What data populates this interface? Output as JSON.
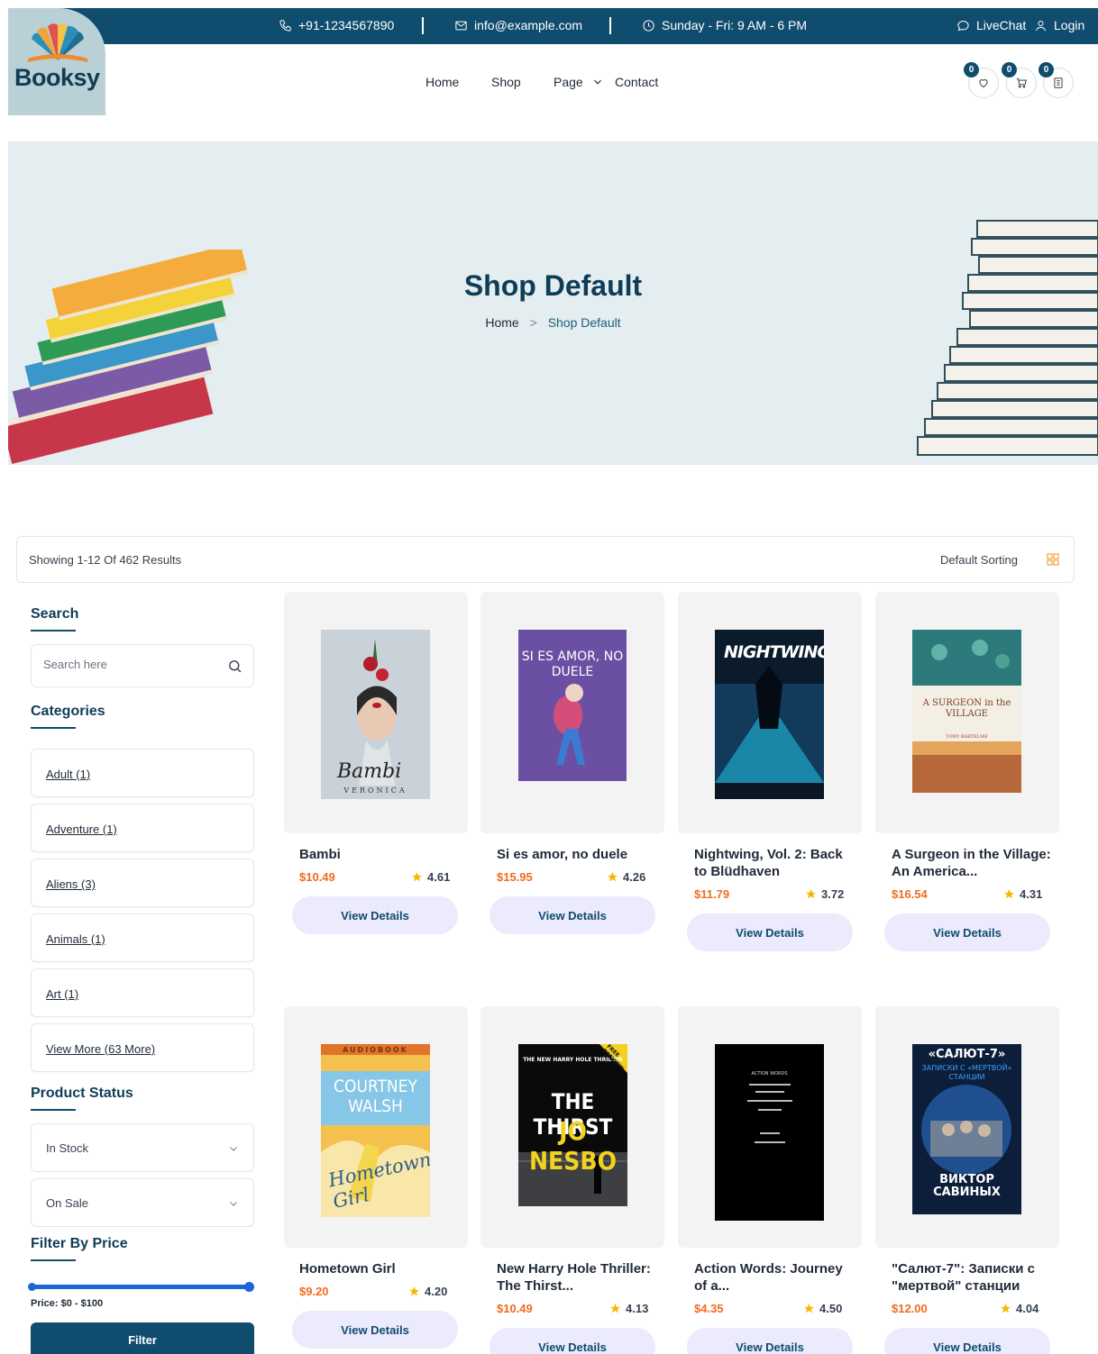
{
  "topbar": {
    "phone": "+91-1234567890",
    "email": "info@example.com",
    "hours": "Sunday - Fri: 9 AM - 6 PM",
    "livechat": "LiveChat",
    "login": "Login"
  },
  "logo": {
    "text": "Booksy"
  },
  "nav": {
    "home": "Home",
    "shop": "Shop",
    "page": "Page",
    "contact": "Contact"
  },
  "header_counts": {
    "wishlist": "0",
    "cart": "0",
    "compare": "0"
  },
  "hero": {
    "title": "Shop Default",
    "crumb_home": "Home",
    "crumb_current": "Shop Default"
  },
  "results": {
    "count": "Showing 1-12 Of 462 Results",
    "sorting": "Default Sorting"
  },
  "sidebar": {
    "search_heading": "Search",
    "search_placeholder": "Search here",
    "categories_heading": "Categories",
    "categories": [
      "Adult (1)",
      "Adventure (1)",
      "Aliens (3)",
      "Animals (1)",
      "Art (1)",
      "View More (63 More)"
    ],
    "status_heading": "Product Status",
    "status_options": [
      "In Stock",
      "On Sale"
    ],
    "price_heading": "Filter By Price",
    "price_label": "Price: $0 - $100",
    "price_range_fraction": [
      0,
      1
    ],
    "filter_button": "Filter"
  },
  "products": [
    {
      "title": "Bambi",
      "price": "$10.49",
      "rating": "4.61",
      "button": "View Details",
      "cover_title": "Bambi",
      "cover_author": "VERONICA"
    },
    {
      "title": "Si es amor, no duele",
      "price": "$15.95",
      "rating": "4.26",
      "button": "View Details",
      "cover_title": "SI ES AMOR, NO DUELE"
    },
    {
      "title": "Nightwing, Vol. 2: Back to Blüdhaven",
      "price": "$11.79",
      "rating": "3.72",
      "button": "View Details",
      "cover_title": "NIGHTWING"
    },
    {
      "title": "A Surgeon in the Village: An America...",
      "price": "$16.54",
      "rating": "4.31",
      "button": "View Details",
      "cover_title": "A SURGEON in the VILLAGE",
      "cover_author": "TONY BARTELME"
    },
    {
      "title": "Hometown Girl",
      "price": "$9.20",
      "rating": "4.20",
      "button": "View Details",
      "cover_top": "AUDIOBOOK",
      "cover_title": "COURTNEY WALSH",
      "cover_script": "Hometown Girl"
    },
    {
      "title": "New Harry Hole Thriller: The Thirst...",
      "price": "$10.49",
      "rating": "4.13",
      "button": "View Details",
      "cover_title": "THE THIRST",
      "cover_author": "JO NESBO",
      "cover_top": "THE NEW HARRY HOLE THRILLER",
      "cover_badge": "FREE PREVIEW"
    },
    {
      "title": "Action Words: Journey of a...",
      "price": "$4.35",
      "rating": "4.50",
      "button": "View Details",
      "cover_title": "ACTION WORDS"
    },
    {
      "title": "\"Салют-7\": Записки с \"мертвой\" станции",
      "price": "$12.00",
      "rating": "4.04",
      "button": "View Details",
      "cover_title": "«САЛЮТ-7»",
      "cover_sub": "ЗАПИСКИ С «МЕРТВОЙ» СТАНЦИИ",
      "cover_author": "ВИКТОР САВИНЫХ"
    }
  ],
  "colors": {
    "primary": "#0f4c6e",
    "price": "#f26b1d",
    "star": "#f5b800",
    "button_bg": "#eceafd",
    "hero_bg": "#e4edef"
  }
}
